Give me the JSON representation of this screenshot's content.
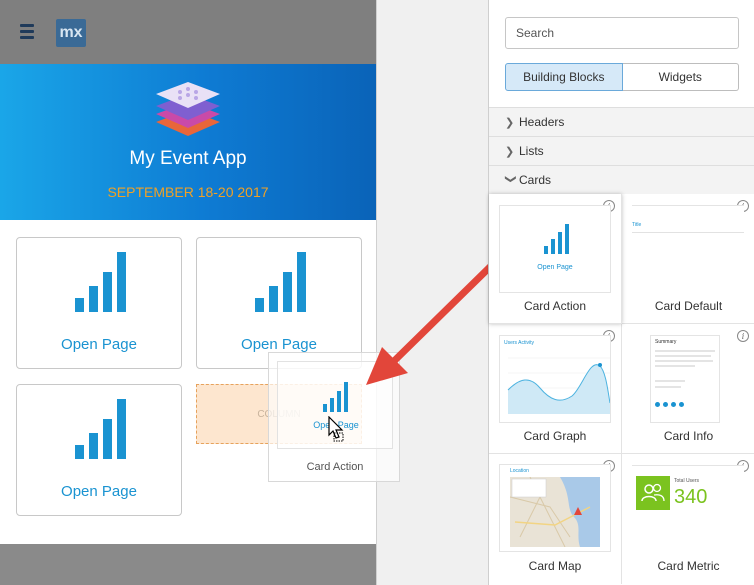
{
  "app": {
    "title": "My Event App",
    "date": "SEPTEMBER 18-20 2017",
    "logo_text": "mx",
    "tiles": [
      {
        "label": "Open Page"
      },
      {
        "label": "Open Page"
      },
      {
        "label": "Open Page"
      }
    ],
    "drop_zone_label": "COLUMN",
    "drag_ghost": {
      "open_label": "Open Page",
      "caption": "Card Action"
    }
  },
  "toolbox": {
    "search_placeholder": "Search",
    "tabs": [
      {
        "label": "Building Blocks",
        "active": true
      },
      {
        "label": "Widgets",
        "active": false
      }
    ],
    "sections": [
      {
        "label": "Headers",
        "expanded": false
      },
      {
        "label": "Lists",
        "expanded": false
      },
      {
        "label": "Cards",
        "expanded": true
      }
    ],
    "cards": [
      {
        "name": "Card Action",
        "thumb_text": "Open Page"
      },
      {
        "name": "Card Default",
        "thumb_text": "Title"
      },
      {
        "name": "Card Graph",
        "thumb_text": "Users Activity"
      },
      {
        "name": "Card Info",
        "thumb_text": "Summary"
      },
      {
        "name": "Card Map",
        "thumb_text": "Location"
      },
      {
        "name": "Card Metric",
        "thumb_text": "Total Users",
        "metric_value": "340"
      }
    ]
  },
  "colors": {
    "hero_start": "#1aa6e8",
    "hero_end": "#0a63b8",
    "date_accent": "#f0a125",
    "link_blue": "#1a93d1",
    "metric_green": "#7bc31f",
    "arrow_red": "#e2463a"
  },
  "icons": [
    "hamburger-icon",
    "mx-logo",
    "layers-logo",
    "signal-bars-icon",
    "info-icon",
    "chevron-right-icon",
    "chevron-down-icon",
    "cursor-icon",
    "users-icon"
  ]
}
